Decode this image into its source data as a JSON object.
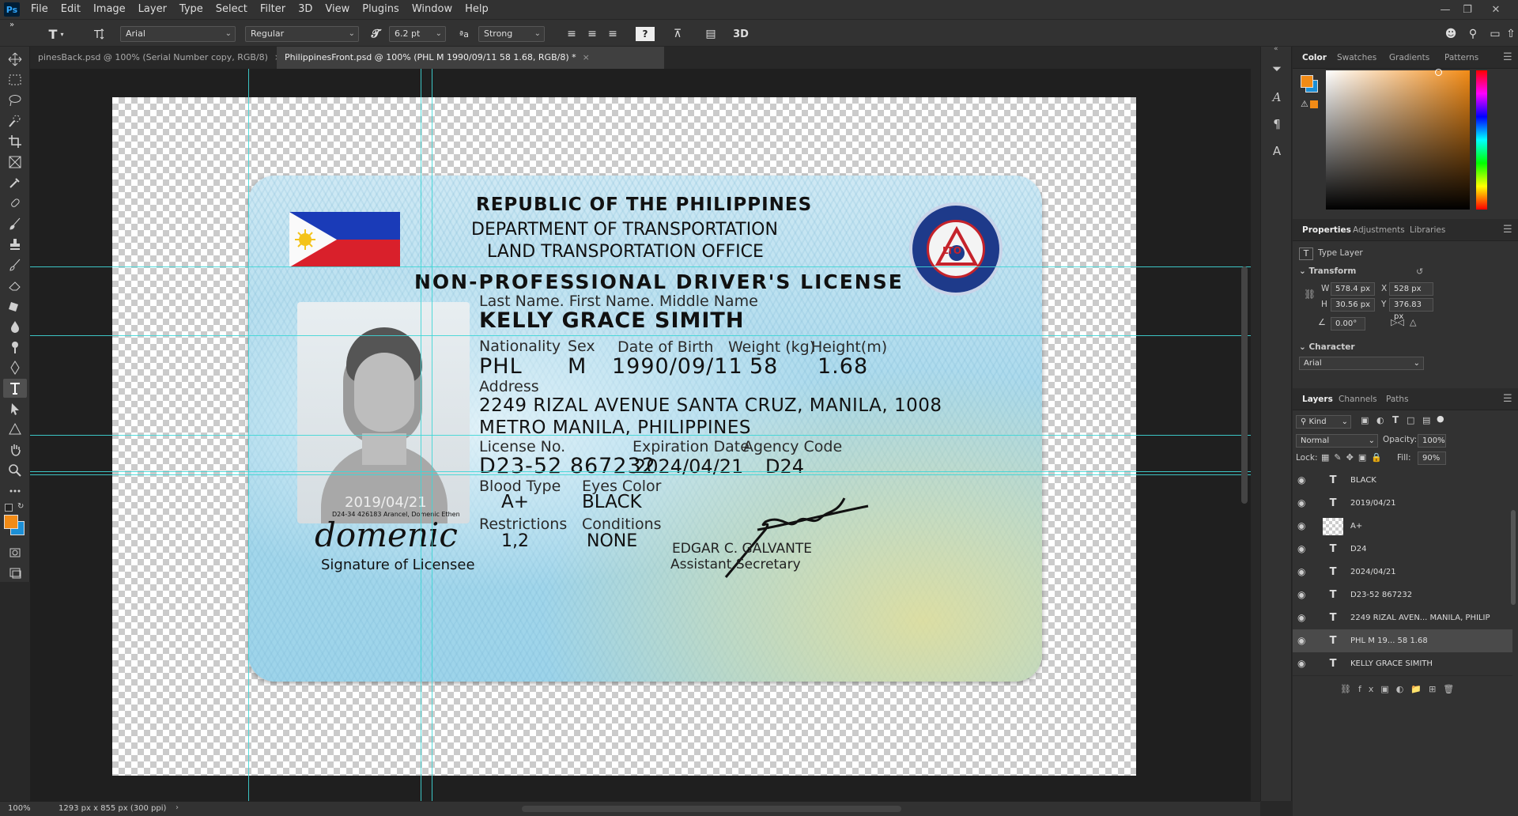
{
  "app": {
    "logo": "Ps"
  },
  "menu": [
    "File",
    "Edit",
    "Image",
    "Layer",
    "Type",
    "Select",
    "Filter",
    "3D",
    "View",
    "Plugins",
    "Window",
    "Help"
  ],
  "options": {
    "font_family": "Arial",
    "font_style": "Regular",
    "font_size": "6.2 pt",
    "aa_label": "ªa",
    "antialias": "Strong",
    "warp_icon": "?",
    "three_d": "3D"
  },
  "tabs": [
    {
      "label": "pinesBack.psd @ 100% (Serial Number copy, RGB/8)",
      "active": false
    },
    {
      "label": "PhilippinesFront.psd @ 100% (PHL        M       1990/09/11        58        1.68, RGB/8) *",
      "active": true
    }
  ],
  "card": {
    "republic": "REPUBLIC OF THE PHILIPPINES",
    "department": "DEPARTMENT OF TRANSPORTATION",
    "office": "LAND TRANSPORTATION OFFICE",
    "license_type": "NON-PROFESSIONAL DRIVER'S LICENSE",
    "seal_text": "LTO",
    "name_label": "Last Name. First Name. Middle Name",
    "name": "KELLY GRACE SIMITH",
    "nationality_label": "Nationality",
    "nationality": "PHL",
    "sex_label": "Sex",
    "sex": "M",
    "dob_label": "Date of Birth",
    "dob": "1990/09/11",
    "weight_label": "Weight (kg)",
    "weight": "58",
    "height_label": "Height(m)",
    "height": "1.68",
    "address_label": "Address",
    "address_1": "2249 RIZAL AVENUE SANTA CRUZ, MANILA, 1008",
    "address_2": "METRO MANILA, PHILIPPINES",
    "license_no_label": "License No.",
    "license_no": "D23-52 867232",
    "expiration_label": "Expiration Date",
    "expiration": "2024/04/21",
    "agency_label": "Agency Code",
    "agency": "D24",
    "blood_label": "Blood Type",
    "blood": "A+",
    "eyes_label": "Eyes Color",
    "eyes": "BLACK",
    "restrictions_label": "Restrictions",
    "restrictions": "1,2",
    "conditions_label": "Conditions",
    "conditions": "NONE",
    "issue_date": "2019/04/21",
    "serial_line": "D24-34 426183 Arancel, Domenic Ethen",
    "licensee_signature": "domenic",
    "signature_caption": "Signature of Licensee",
    "official_name": "EDGAR C. GALVANTE",
    "official_title": "Assistant Secretary"
  },
  "status": {
    "zoom": "100%",
    "doc_info": "1293 px x 855 px (300 ppi)"
  },
  "panels": {
    "color_tabs": [
      "Color",
      "Swatches",
      "Gradients",
      "Patterns"
    ],
    "properties_tabs": [
      "Properties",
      "Adjustments",
      "Libraries"
    ],
    "layer_kind": "Type Layer",
    "transform_label": "Transform",
    "w_label": "W",
    "w": "578.4 px",
    "x_label": "X",
    "x": "528 px",
    "h_label": "H",
    "h": "30.56 px",
    "y_label": "Y",
    "y": "376.83 px",
    "angle": "0.00°",
    "character_label": "Character",
    "character_font": "Arial",
    "layers_tabs": [
      "Layers",
      "Channels",
      "Paths"
    ],
    "kind_filter": "Kind",
    "blend_mode": "Normal",
    "opacity_label": "Opacity:",
    "opacity": "100%",
    "lock_label": "Lock:",
    "fill_label": "Fill:",
    "fill": "90%",
    "fx": "fx"
  },
  "layers": [
    {
      "name": "BLACK",
      "thumb": "T",
      "selected": false
    },
    {
      "name": "2019/04/21",
      "thumb": "T",
      "selected": false
    },
    {
      "name": "A+",
      "thumb": "img",
      "selected": false
    },
    {
      "name": "D24",
      "thumb": "T",
      "selected": false
    },
    {
      "name": "2024/04/21",
      "thumb": "T",
      "selected": false
    },
    {
      "name": "D23-52 867232",
      "thumb": "T",
      "selected": false
    },
    {
      "name": "2249 RIZAL AVEN... MANILA, PHILIP",
      "thumb": "T",
      "selected": false
    },
    {
      "name": "PHL        M      19...        58           1.68",
      "thumb": "T",
      "selected": true
    },
    {
      "name": "KELLY GRACE SIMITH",
      "thumb": "T",
      "selected": false
    }
  ],
  "colors": {
    "foreground": "#f28b16",
    "background": "#1c8fd6",
    "guide": "#3fd6d6",
    "accent": "#31a8ff"
  }
}
